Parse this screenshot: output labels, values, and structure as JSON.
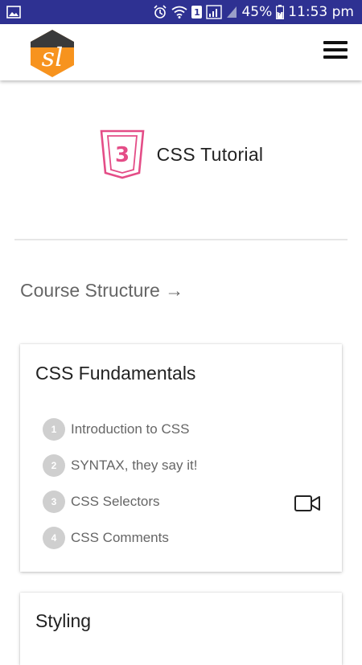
{
  "status_bar": {
    "battery": "45%",
    "time": "11:53 pm",
    "sim_badge": "1"
  },
  "app": {
    "logo_text": "sl",
    "colors": {
      "logo_dark": "#3a3a3a",
      "logo_orange": "#f7931e",
      "status_bar": "#2e3192",
      "css_logo": "#e44d87"
    }
  },
  "hero": {
    "title": "CSS Tutorial",
    "icon": "css3-icon",
    "icon_number": "3"
  },
  "course_structure": {
    "label": "Course Structure →"
  },
  "cards": [
    {
      "title": "CSS Fundamentals",
      "lessons": [
        {
          "num": "1",
          "label": "Introduction to CSS"
        },
        {
          "num": "2",
          "label": "SYNTAX, they say it!"
        },
        {
          "num": "3",
          "label": "CSS Selectors"
        },
        {
          "num": "4",
          "label": "CSS Comments"
        }
      ],
      "media_icon": "video-camera-icon"
    },
    {
      "title": "Styling"
    }
  ]
}
